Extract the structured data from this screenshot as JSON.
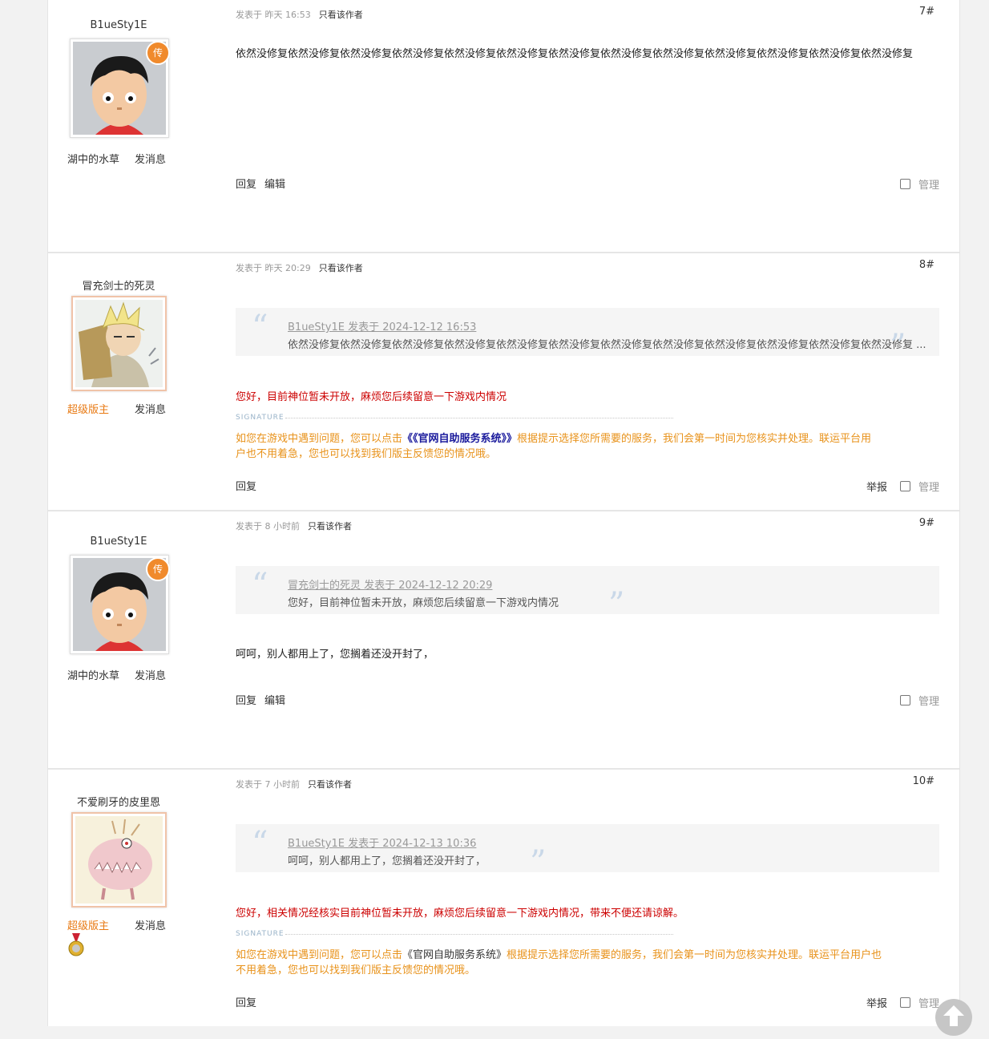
{
  "posts": [
    {
      "username": "B1ueSty1E",
      "legend_badge": "传",
      "role": "湖中的水草",
      "message_label": "发消息",
      "meta_time": "发表于 昨天 16:53",
      "only_author": "只看该作者",
      "floor": "7#",
      "body": "依然没修复依然没修复依然没修复依然没修复依然没修复依然没修复依然没修复依然没修复依然没修复依然没修复依然没修复依然没修复依然没修复",
      "reply": "回复",
      "edit": "编辑",
      "manage": "管理"
    },
    {
      "username": "冒充剑士的死灵",
      "role": "超级版主",
      "message_label": "发消息",
      "meta_time": "发表于 昨天 20:29",
      "only_author": "只看该作者",
      "floor": "8#",
      "quote_header": "B1ueSty1E 发表于 2024-12-12 16:53",
      "quote_body": "依然没修复依然没修复依然没修复依然没修复依然没修复依然没修复依然没修复依然没修复依然没修复依然没修复依然没修复依然没修复 ...",
      "body": "您好，目前神位暂未开放，麻烦您后续留意一下游戏内情况",
      "signature_label": "SIGNATURE",
      "sig_pre": "如您在游戏中遇到问题，您可以点击",
      "sig_link": "《《官网自助服务系统》》",
      "sig_post_line1": "根据提示选择您所需要的服务，我们会第一时间为您核实并处理。联运平台用",
      "sig_line2": "户也不用着急，您也可以找到我们版主反馈您的情况哦。",
      "reply": "回复",
      "report": "举报",
      "manage": "管理"
    },
    {
      "username": "B1ueSty1E",
      "legend_badge": "传",
      "role": "湖中的水草",
      "message_label": "发消息",
      "meta_time": "发表于 8 小时前",
      "only_author": "只看该作者",
      "floor": "9#",
      "quote_header": "冒充剑士的死灵 发表于 2024-12-12 20:29",
      "quote_body": "您好，目前神位暂未开放，麻烦您后续留意一下游戏内情况",
      "body": "呵呵，别人都用上了，您搁着还没开封了，",
      "reply": "回复",
      "edit": "编辑",
      "manage": "管理"
    },
    {
      "username": "不爱刷牙的皮里恩",
      "role": "超级版主",
      "message_label": "发消息",
      "meta_time": "发表于 7 小时前",
      "only_author": "只看该作者",
      "floor": "10#",
      "quote_header": "B1ueSty1E 发表于 2024-12-13 10:36",
      "quote_body": "呵呵，别人都用上了，您搁着还没开封了，",
      "body": "您好，相关情况经核实目前神位暂未开放，麻烦您后续留意一下游戏内情况，带来不便还请谅解。",
      "signature_label": "SIGNATURE",
      "sig_pre": "如您在游戏中遇到问题，您可以点击",
      "sig_link": "《官网自助服务系统》",
      "sig_post_line1": "根据提示选择您所需要的服务，我们会第一时间为您核实并处理。联运平台用户也",
      "sig_line2": "不用着急，您也可以找到我们版主反馈您的情况哦。",
      "reply": "回复",
      "report": "举报",
      "manage": "管理"
    }
  ],
  "icons": {
    "back_to_top": "arrow-up-icon",
    "medal": "medal-icon"
  }
}
